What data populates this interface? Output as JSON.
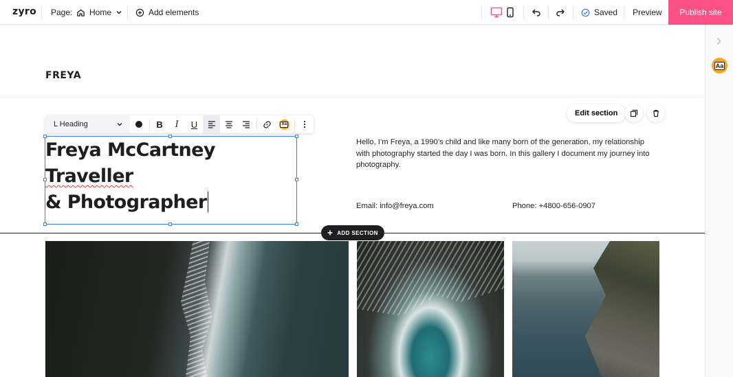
{
  "topbar": {
    "logo": "zyro",
    "page_label": "Page:",
    "page_name": "Home",
    "add_elements": "Add elements",
    "saved": "Saved",
    "preview": "Preview",
    "publish": "Publish site"
  },
  "canvas": {
    "brand": "FREYA",
    "heading_line1_a": "Freya McCartney ",
    "heading_line1_b": "Traveller",
    "heading_line2": "& Photographer",
    "intro": "Hello, I’m Freya, a 1990’s child and like many born of the generation, my relationship with photography started the day I was born. In this gallery I document my journey into photography.",
    "email": "Email: info@freya.com",
    "phone": "Phone: +4800-656-0907",
    "edit_section": "Edit section",
    "add_section": "ADD SECTION"
  },
  "toolbar": {
    "style_select": "L Heading",
    "bold": "B",
    "italic": "I",
    "underline": "U",
    "ai_badge": "Aa"
  },
  "rail": {
    "ai_badge": "Aa"
  },
  "colors": {
    "accent": "#357df9",
    "publish": "#fc5185",
    "dark": "#1d1e20"
  }
}
